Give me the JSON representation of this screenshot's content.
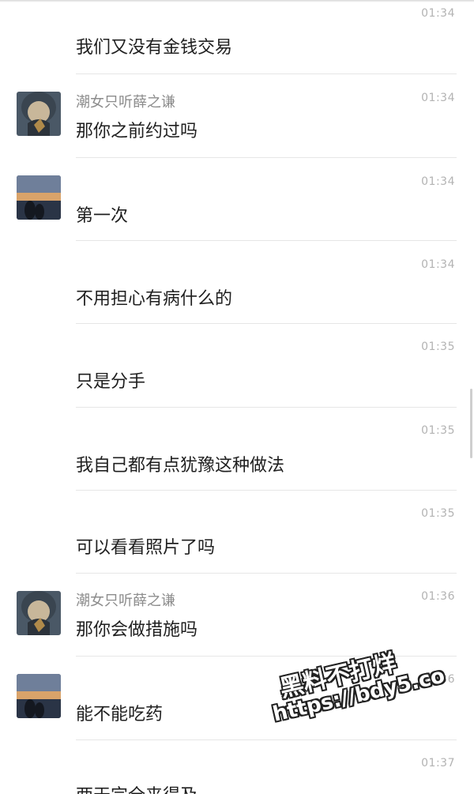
{
  "messages": [
    {
      "time": "01:34",
      "text": "我们又没有金钱交易"
    },
    {
      "time": "01:34",
      "sender": "潮女只听薛之谦",
      "text": "那你之前约过吗",
      "avatar": "hooded-person-avatar"
    },
    {
      "time": "01:34",
      "text": "第一次",
      "avatar": "sunset-couple-avatar"
    },
    {
      "time": "01:34",
      "text": "不用担心有病什么的"
    },
    {
      "time": "01:35",
      "text": "只是分手"
    },
    {
      "time": "01:35",
      "text": "我自己都有点犹豫这种做法"
    },
    {
      "time": "01:35",
      "text": "可以看看照片了吗"
    },
    {
      "time": "01:36",
      "sender": "潮女只听薛之谦",
      "text": "那你会做措施吗",
      "avatar": "hooded-person-avatar"
    },
    {
      "time": "01:36",
      "text": "能不能吃药",
      "avatar": "sunset-couple-avatar"
    },
    {
      "time": "01:37",
      "text": "两天完全来得及"
    }
  ],
  "watermark": {
    "line1": "黑料不打烊",
    "line2": "https://bdy5.co"
  }
}
